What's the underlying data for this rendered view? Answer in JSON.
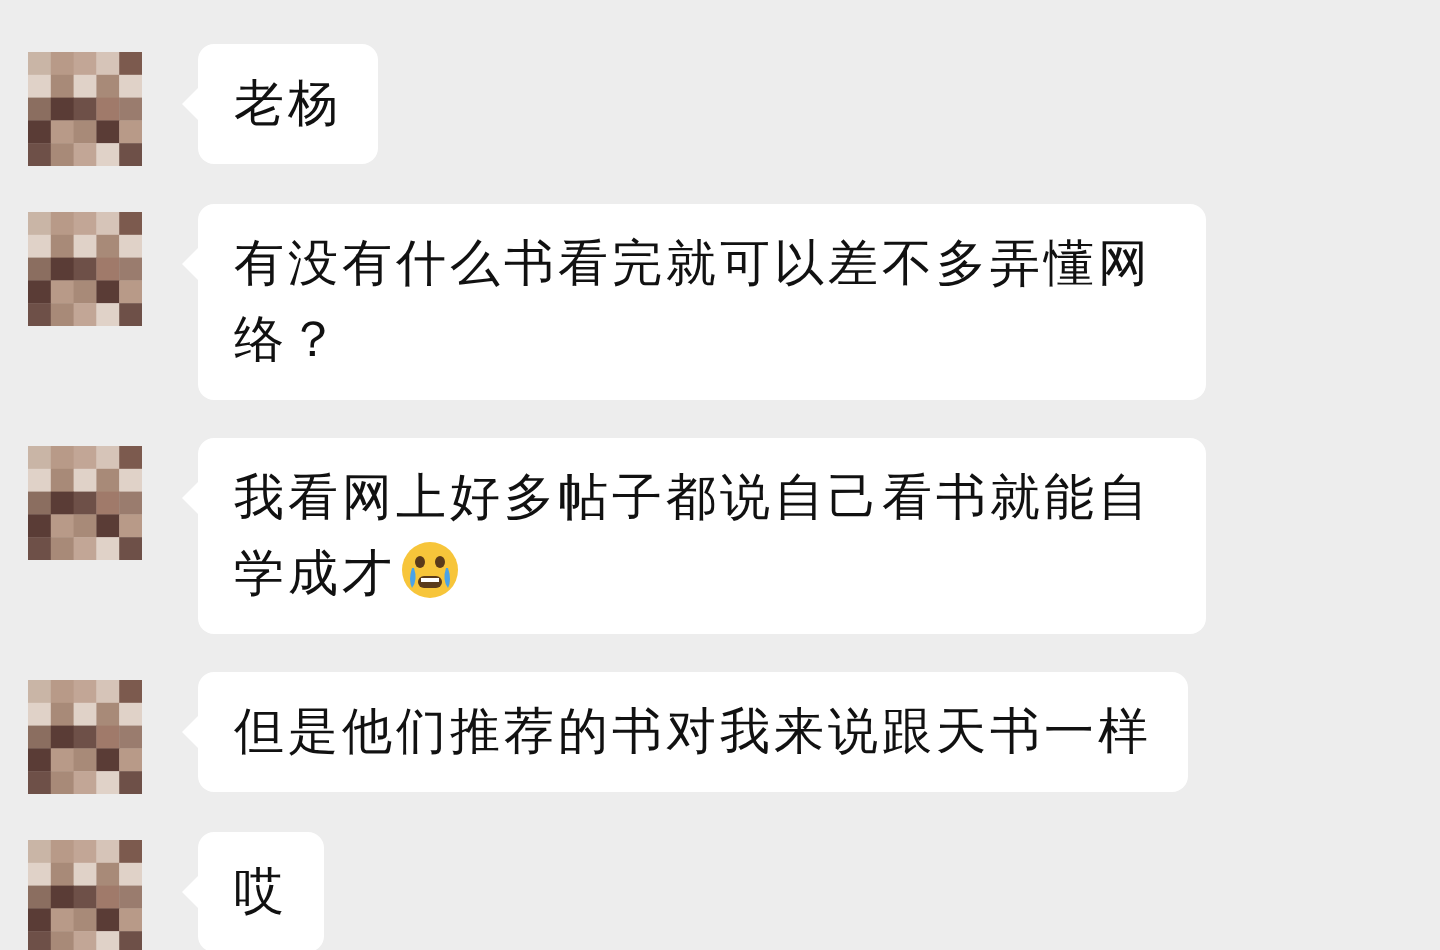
{
  "messages": [
    {
      "text": "老杨",
      "emoji": false
    },
    {
      "text": "有没有什么书看完就可以差不多弄懂网络？",
      "emoji": false
    },
    {
      "text": "我看网上好多帖子都说自己看书就能自学成才",
      "emoji": true
    },
    {
      "text": "但是他们推荐的书对我来说跟天书一样",
      "emoji": false
    },
    {
      "text": "哎",
      "emoji": false
    }
  ]
}
